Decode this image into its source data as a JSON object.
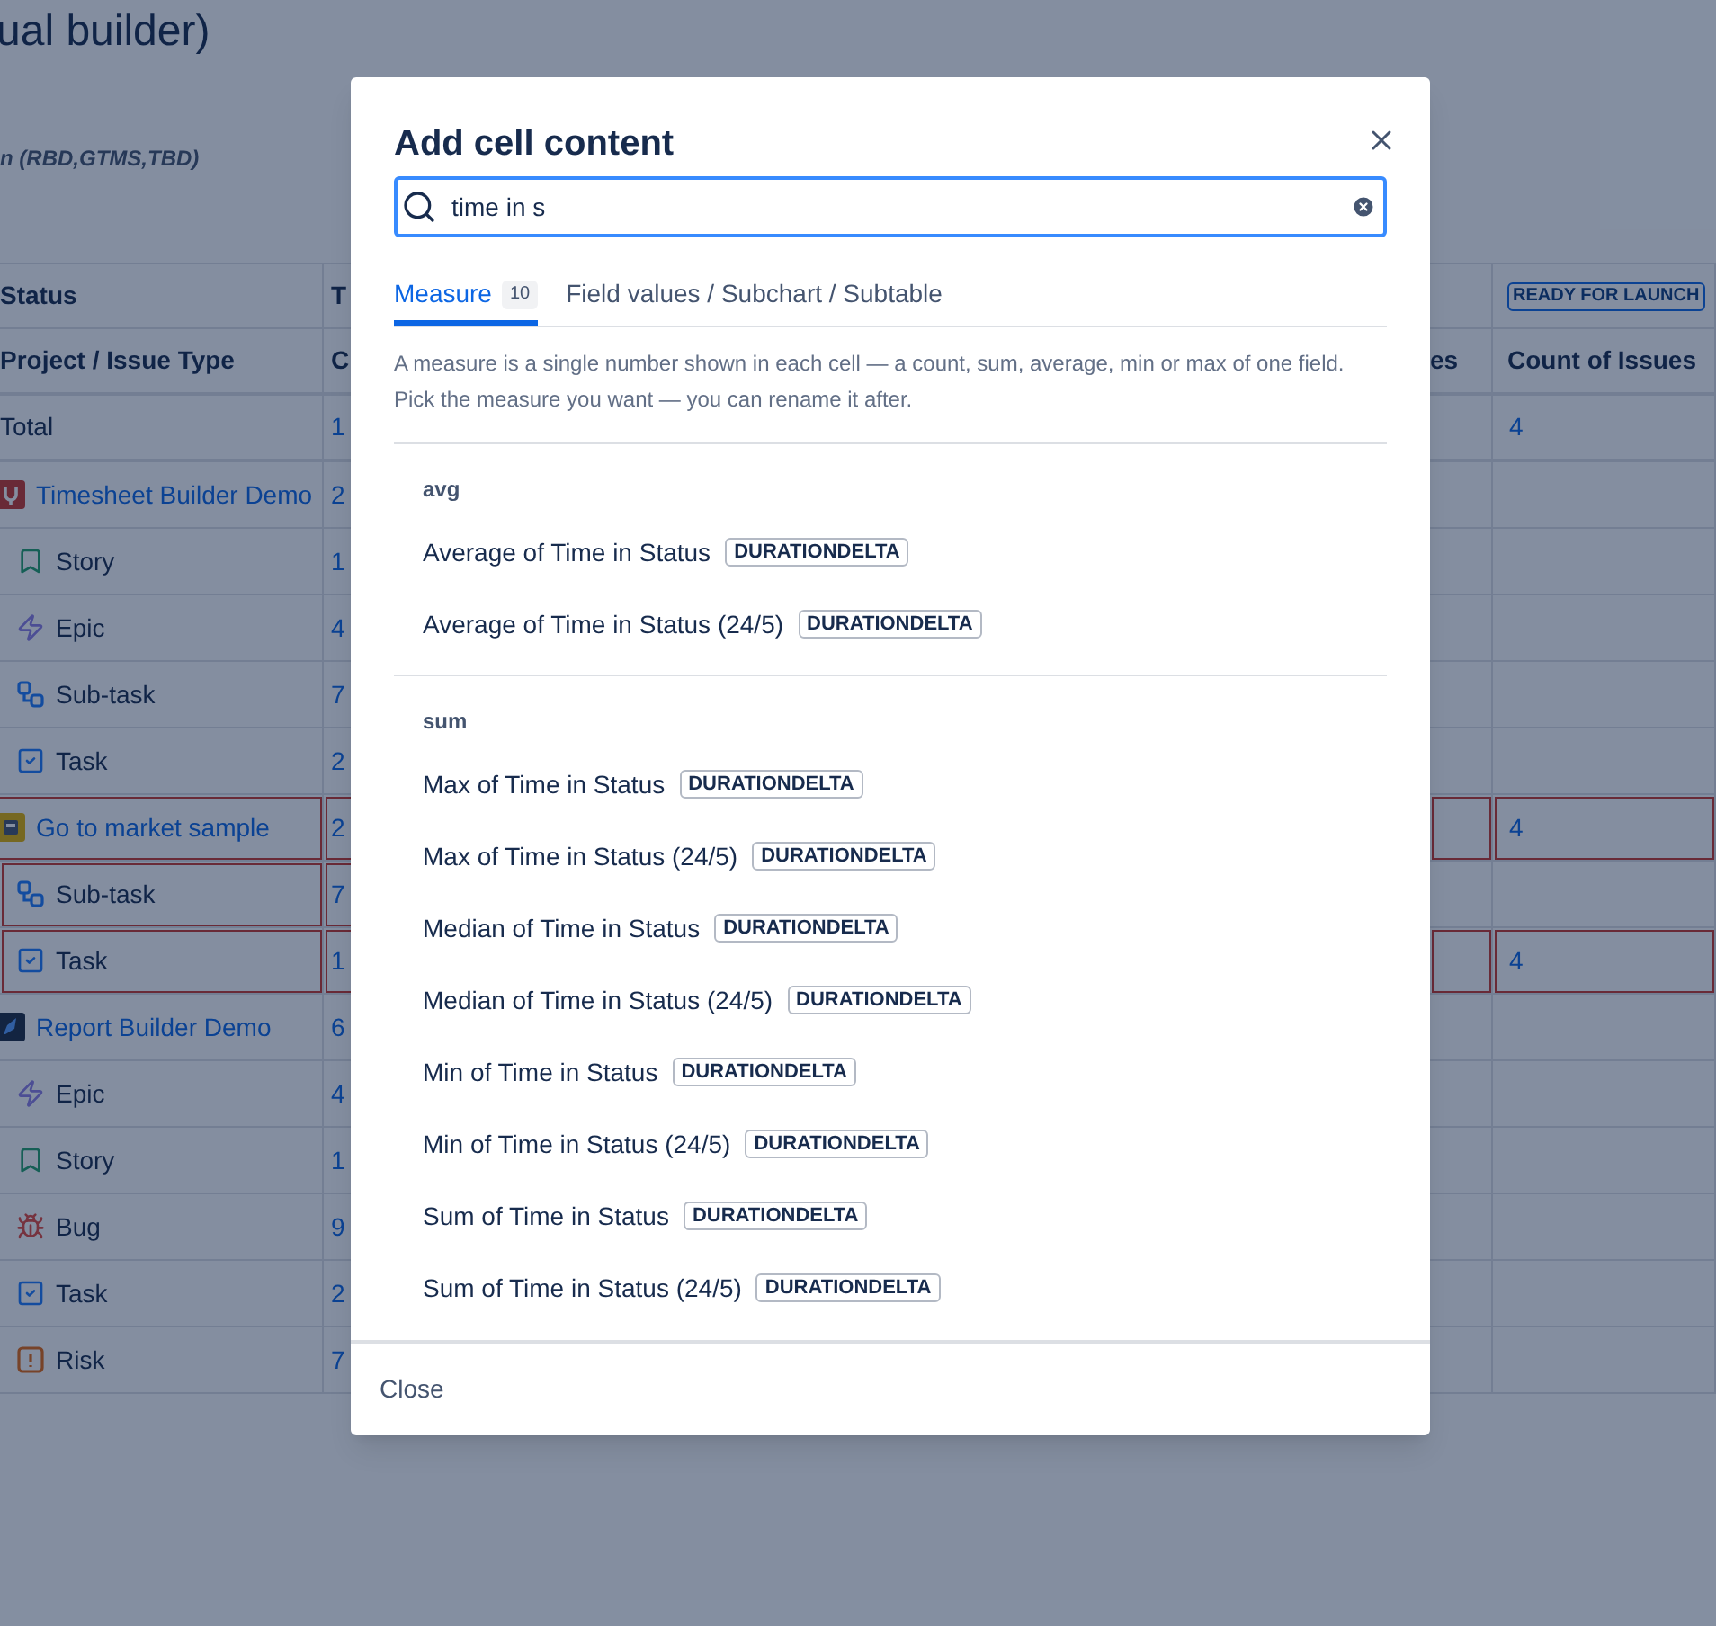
{
  "page": {
    "title": "ual builder)",
    "subtitle": "n (RBD,GTMS,TBD)"
  },
  "table": {
    "status_row": {
      "column_1": "Status",
      "column_2": "T",
      "status_badge": "READY FOR LAUNCH"
    },
    "header_row": {
      "column_1": "Project / Issue Type",
      "column_2": "C",
      "column_3": "es",
      "column_4": "Count of Issues"
    },
    "rows": [
      {
        "kind": "total",
        "label": "Total",
        "column_2": "1",
        "count": "4",
        "highlighted": false
      },
      {
        "kind": "project",
        "label": "Timesheet Builder Demo",
        "column_2": "2",
        "highlighted": false
      },
      {
        "kind": "story",
        "label": "Story",
        "column_2": "1",
        "highlighted": false
      },
      {
        "kind": "epic",
        "label": "Epic",
        "column_2": "4",
        "highlighted": false
      },
      {
        "kind": "subtask",
        "label": "Sub-task",
        "column_2": "7",
        "highlighted": false
      },
      {
        "kind": "task",
        "label": "Task",
        "column_2": "2",
        "highlighted": false
      },
      {
        "kind": "project",
        "label": "Go to market sample",
        "column_2": "2",
        "count": "4",
        "highlighted": true
      },
      {
        "kind": "subtask",
        "label": "Sub-task",
        "column_2": "7",
        "highlighted": true
      },
      {
        "kind": "task",
        "label": "Task",
        "column_2": "1",
        "count": "4",
        "highlighted": true
      },
      {
        "kind": "project",
        "label": "Report Builder Demo",
        "column_2": "6",
        "highlighted": false
      },
      {
        "kind": "epic",
        "label": "Epic",
        "column_2": "4",
        "highlighted": false
      },
      {
        "kind": "story",
        "label": "Story",
        "column_2": "1",
        "highlighted": false
      },
      {
        "kind": "bug",
        "label": "Bug",
        "column_2": "9",
        "highlighted": false
      },
      {
        "kind": "task",
        "label": "Task",
        "column_2": "2",
        "highlighted": false
      },
      {
        "kind": "risk",
        "label": "Risk",
        "column_2": "7",
        "highlighted": false
      }
    ]
  },
  "dialog": {
    "title": "Add cell content",
    "search": {
      "value": "time in s"
    },
    "tabs": [
      {
        "label": "Measure",
        "count": "10",
        "selected": true
      },
      {
        "label": "Field values / Subchart / Subtable",
        "selected": false
      }
    ],
    "description": "A measure is a single number shown in each cell — a count, sum, average, min or max of one field. Pick the measure you want — you can rename it after.",
    "groups": [
      {
        "name": "avg",
        "items": [
          {
            "label": "Average of Time in Status",
            "badge": "DURATIONDELTA"
          },
          {
            "label": "Average of Time in Status (24/5)",
            "badge": "DURATIONDELTA"
          }
        ]
      },
      {
        "name": "sum",
        "items": [
          {
            "label": "Max of Time in Status",
            "badge": "DURATIONDELTA"
          },
          {
            "label": "Max of Time in Status (24/5)",
            "badge": "DURATIONDELTA"
          },
          {
            "label": "Median of Time in Status",
            "badge": "DURATIONDELTA"
          },
          {
            "label": "Median of Time in Status (24/5)",
            "badge": "DURATIONDELTA"
          },
          {
            "label": "Min of Time in Status",
            "badge": "DURATIONDELTA"
          },
          {
            "label": "Min of Time in Status (24/5)",
            "badge": "DURATIONDELTA"
          },
          {
            "label": "Sum of Time in Status",
            "badge": "DURATIONDELTA"
          },
          {
            "label": "Sum of Time in Status (24/5)",
            "badge": "DURATIONDELTA"
          }
        ]
      }
    ],
    "close_button": "Close"
  }
}
